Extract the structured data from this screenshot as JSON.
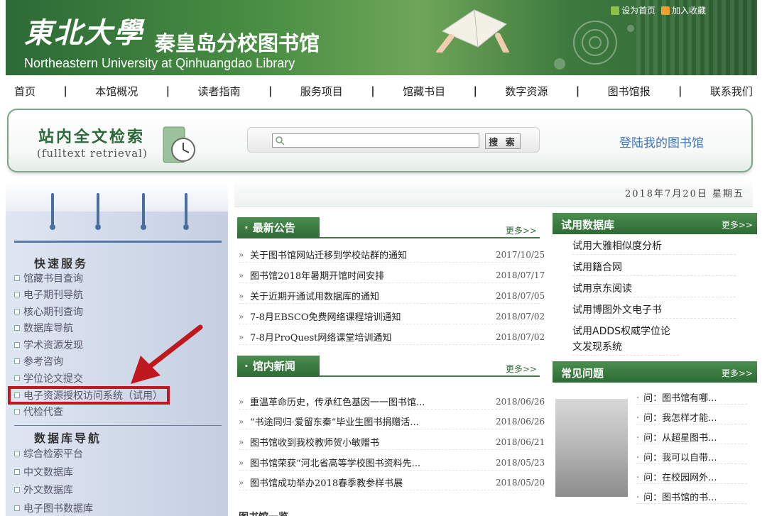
{
  "header": {
    "logo_text": "東北大學",
    "title_cn": "秦皇岛分校图书馆",
    "title_en": "Northeastern University at Qinhuangdao Library",
    "top_links": [
      "设为首页",
      "加入收藏"
    ]
  },
  "nav": {
    "items": [
      "首页",
      "本馆概况",
      "读者指南",
      "服务项目",
      "馆藏书目",
      "数字资源",
      "图书馆报",
      "联系我们"
    ],
    "separator": "|"
  },
  "search": {
    "title": "站内全文检索",
    "subtitle": "(fulltext retrieval)",
    "button_label": "搜 索",
    "input_value": "",
    "login_link": "登陆我的图书馆"
  },
  "date": "2018年7月20日  星期五",
  "quick_services": {
    "title": "快速服务",
    "items": [
      "馆藏书目查询",
      "电子期刊导航",
      "核心期刊查询",
      "数据库导航",
      "学术资源发现",
      "参考咨询",
      "学位论文提交",
      "电子资源授权访问系统（试用）",
      "代检代查"
    ]
  },
  "db_nav": {
    "title": "数据库导航",
    "items": [
      "综合检索平台",
      "中文数据库",
      "外文数据库",
      "电子图书数据库"
    ]
  },
  "announcements": {
    "title": "最新公告",
    "more": "更多>>",
    "items": [
      {
        "title": "关于图书馆网站迁移到学校站群的通知",
        "date": "2017/10/25"
      },
      {
        "title": "图书馆2018年暑期开馆时间安排",
        "date": "2018/07/17"
      },
      {
        "title": "关于近期开通试用数据库的通知",
        "date": "2018/07/05"
      },
      {
        "title": "7-8月EBSCO免费网络课程培训通知",
        "date": "2018/07/02"
      },
      {
        "title": "7-8月ProQuest网络课堂培训通知",
        "date": "2018/07/02"
      }
    ]
  },
  "news": {
    "title": "馆内新闻",
    "more": "更多>>",
    "items": [
      {
        "title": "重温革命历史，传承红色基因一一图书馆...",
        "date": "2018/06/26"
      },
      {
        "title": "“书途同归·爱留东秦”毕业生图书捐赠活...",
        "date": "2018/06/26"
      },
      {
        "title": "图书馆收到我校教师贺小敏赠书",
        "date": "2018/06/21"
      },
      {
        "title": "图书馆荣获“河北省高等学校图书资料先...",
        "date": "2018/05/23"
      },
      {
        "title": "图书馆成功举办2018春季教参样书展",
        "date": "2018/05/20"
      }
    ],
    "marker": "»"
  },
  "trial_db": {
    "title": "试用数据库",
    "more": "更多>>",
    "items": [
      "试用大雅相似度分析",
      "试用籍合网",
      "试用京东阅读",
      "试用博图外文电子书",
      "试用ADDS权威学位论文发现系统"
    ]
  },
  "faq": {
    "title": "常见问题",
    "more": "更多>>",
    "items": [
      "问：图书馆有哪...",
      "问：我怎样才能...",
      "问：从超星图书...",
      "问：我可以自带...",
      "问：在校园网外...",
      "问：图书馆的书..."
    ]
  },
  "bottom_partial": "图书馆一览",
  "colors": {
    "accent_green": "#2e6a35",
    "highlight_red": "#c0181f",
    "link_blue": "#3f77b8"
  }
}
